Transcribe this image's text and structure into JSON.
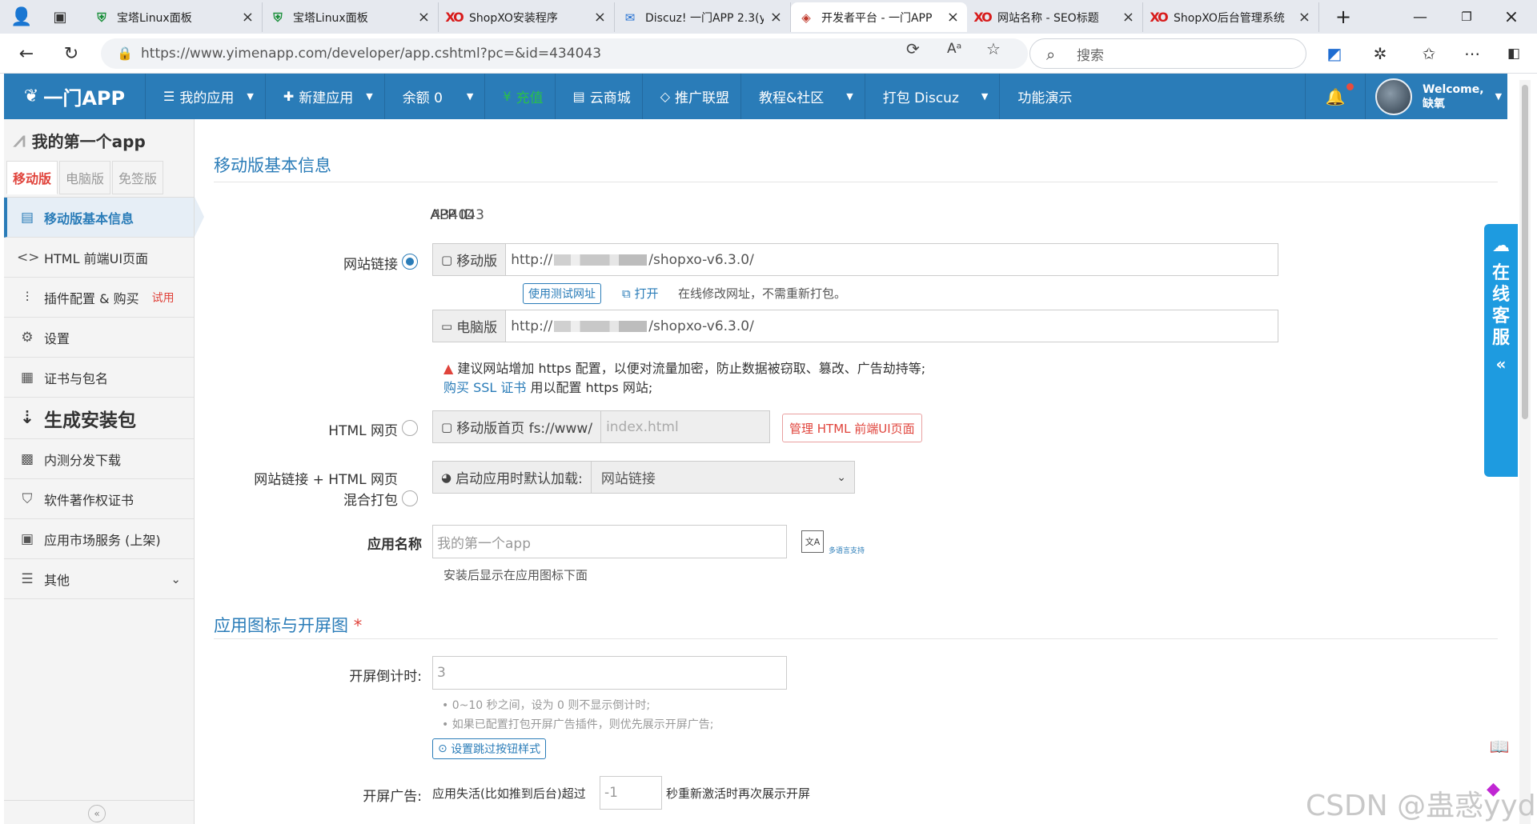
{
  "browser": {
    "tabs": [
      {
        "title": "宝塔Linux面板",
        "icon": "shield-icon"
      },
      {
        "title": "宝塔Linux面板",
        "icon": "shield-icon"
      },
      {
        "title": "ShopXO安装程序",
        "icon": "shopxo-icon"
      },
      {
        "title": "Discuz! 一门APP 2.3(y",
        "icon": "mail-icon"
      },
      {
        "title": "开发者平台 - 一门APP",
        "icon": "diamond-icon"
      },
      {
        "title": "网站名称 - SEO标题",
        "icon": "shopxo-icon"
      },
      {
        "title": "ShopXO后台管理系统",
        "icon": "shopxo-icon"
      }
    ],
    "url": "https://www.yimenapp.com/developer/app.cshtml?pc=&id=434043",
    "search_placeholder": "搜索"
  },
  "header": {
    "logo": "一门APP",
    "menus": [
      {
        "label": "我的应用",
        "icon": "list-icon",
        "caret": true
      },
      {
        "label": "新建应用",
        "icon": "plus-icon",
        "caret": true
      },
      {
        "label": "余额 0",
        "icon": "",
        "caret": true
      },
      {
        "label": "充值",
        "icon": "yuan-icon",
        "caret": false
      },
      {
        "label": "云商城",
        "icon": "store-icon",
        "caret": false
      },
      {
        "label": "推广联盟",
        "icon": "diamond-icon",
        "caret": false
      },
      {
        "label": "教程&社区",
        "icon": "",
        "caret": true
      },
      {
        "label": "打包 Discuz",
        "icon": "",
        "caret": true
      },
      {
        "label": "功能演示",
        "icon": "",
        "caret": false
      }
    ],
    "welcome": "Welcome,",
    "username": "缺氧"
  },
  "sidebar": {
    "app_name": "我的第一个app",
    "version_tabs": [
      "移动版",
      "电脑版",
      "免签版"
    ],
    "items": [
      {
        "label": "移动版基本信息",
        "icon": "doc-icon"
      },
      {
        "label": "HTML 前端UI页面",
        "icon": "code-icon"
      },
      {
        "label": "插件配置 & 购买",
        "icon": "sliders-icon",
        "badge": "试用"
      },
      {
        "label": "设置",
        "icon": "gear-icon"
      },
      {
        "label": "证书与包名",
        "icon": "certificate-icon"
      },
      {
        "label": "生成安装包",
        "icon": "sort-icon"
      },
      {
        "label": "内测分发下载",
        "icon": "qrcode-icon"
      },
      {
        "label": "软件著作权证书",
        "icon": "copyright-icon"
      },
      {
        "label": "应用市场服务 (上架)",
        "icon": "market-icon"
      },
      {
        "label": "其他",
        "icon": "menu-icon"
      }
    ]
  },
  "main": {
    "section1_title": "移动版基本信息",
    "app_id_label": "APP ID",
    "app_id": "434043",
    "site_link_label": "网站链接",
    "mobile_addon": "移动版",
    "mobile_url_prefix": "http://",
    "mobile_url_suffix": "/shopxo-v6.3.0/",
    "test_url_btn": "使用测试网址",
    "open_link": "打开",
    "online_note": "在线修改网址，不需重新打包。",
    "pc_addon": "电脑版",
    "pc_url_prefix": "http://",
    "pc_url_suffix": "/shopxo-v6.3.0/",
    "https_warning": "建议网站增加 https 配置，以便对流量加密，防止数据被窃取、篡改、广告劫持等;",
    "buy_ssl": "购买 SSL 证书",
    "buy_ssl_tail": "用以配置 https 网站;",
    "html_label": "HTML 网页",
    "html_addon": "移动版首页 fs://www/",
    "html_placeholder": "index.html",
    "manage_html_btn": "管理 HTML 前端UI页面",
    "mix_label_1": "网站链接 + HTML 网页",
    "mix_label_2": "混合打包",
    "load_addon": "启动应用时默认加载:",
    "load_value": "网站链接",
    "app_name_label": "应用名称",
    "app_name_value": "我的第一个app",
    "multilang": "多语言支持",
    "app_name_tip": "安装后显示在应用图标下面",
    "section2_title": "应用图标与开屏图",
    "section2_req": "*",
    "countdown_label": "开屏倒计时:",
    "countdown_value": "3",
    "tip1": "• 0~10 秒之间，设为 0 则不显示倒计时;",
    "tip2": "• 如果已配置打包开屏广告插件，则优先展示开屏广告;",
    "skip_btn": "设置跳过按钮样式",
    "ad_label": "开屏广告:",
    "ad_text1": "应用失活(比如推到后台)超过",
    "ad_value": "-1",
    "ad_text2": "秒重新激活时再次展示开屏"
  },
  "float": {
    "kefu": [
      "在",
      "线",
      "客",
      "服"
    ],
    "watermark": "CSDN @蛊惑yyds"
  }
}
